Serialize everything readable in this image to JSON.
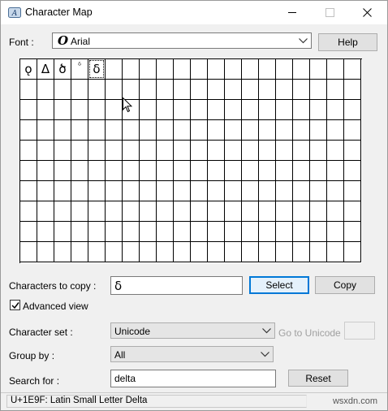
{
  "window": {
    "title": "Character Map"
  },
  "font": {
    "label": "Font :",
    "glyph": "O",
    "value": "Arial"
  },
  "help_label": "Help",
  "grid": {
    "rows": 10,
    "cols": 20,
    "chars": [
      "ǫ",
      "Δ",
      "ծ",
      "ᵟ",
      "ẟ"
    ],
    "small_index": [
      3
    ],
    "selected_index": 4
  },
  "copy": {
    "label": "Characters to copy :",
    "value": "ẟ",
    "select_label": "Select",
    "copy_label": "Copy"
  },
  "advanced": {
    "label": "Advanced view",
    "checked": true
  },
  "charset": {
    "label": "Character set :",
    "value": "Unicode",
    "goto_label": "Go to Unicode :"
  },
  "groupby": {
    "label": "Group by :",
    "value": "All"
  },
  "search": {
    "label": "Search for :",
    "value": "delta",
    "reset_label": "Reset"
  },
  "status": {
    "text": "U+1E9F: Latin Small Letter Delta",
    "watermark": "wsxdn.com"
  }
}
